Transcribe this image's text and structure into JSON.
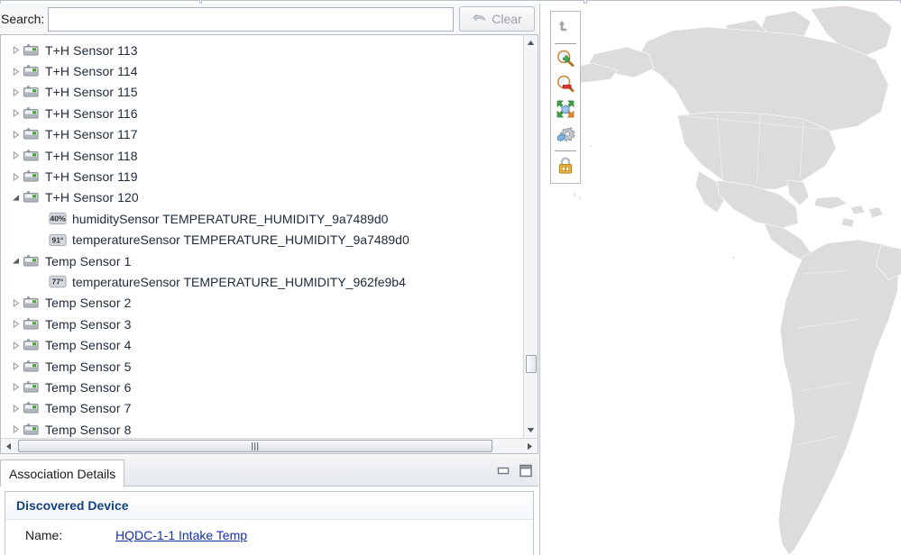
{
  "window": {
    "top_tabs": [
      "",
      "",
      ""
    ]
  },
  "search": {
    "label": "Search:",
    "value": "",
    "placeholder": "",
    "clear_label": "Clear",
    "clear_icon": "undo-arrow-icon",
    "clear_enabled": false
  },
  "tree": {
    "rows": [
      {
        "level": 0,
        "icon": "sensor-device-icon",
        "expanded": false,
        "label": "T+H Sensor 113"
      },
      {
        "level": 0,
        "icon": "sensor-device-icon",
        "expanded": false,
        "label": "T+H Sensor 114"
      },
      {
        "level": 0,
        "icon": "sensor-device-icon",
        "expanded": false,
        "label": "T+H Sensor 115"
      },
      {
        "level": 0,
        "icon": "sensor-device-icon",
        "expanded": false,
        "label": "T+H Sensor 116"
      },
      {
        "level": 0,
        "icon": "sensor-device-icon",
        "expanded": false,
        "label": "T+H Sensor 117"
      },
      {
        "level": 0,
        "icon": "sensor-device-icon",
        "expanded": false,
        "label": "T+H Sensor 118"
      },
      {
        "level": 0,
        "icon": "sensor-device-icon",
        "expanded": false,
        "label": "T+H Sensor 119"
      },
      {
        "level": 0,
        "icon": "sensor-device-icon",
        "expanded": true,
        "label": "T+H Sensor 120"
      },
      {
        "level": 1,
        "icon": "humidity-reading-badge",
        "badge": "40%",
        "label": "humiditySensor TEMPERATURE_HUMIDITY_9a7489d0"
      },
      {
        "level": 1,
        "icon": "temperature-reading-badge",
        "badge": "91°",
        "label": "temperatureSensor TEMPERATURE_HUMIDITY_9a7489d0"
      },
      {
        "level": 0,
        "icon": "sensor-device-icon",
        "expanded": true,
        "label": "Temp Sensor 1"
      },
      {
        "level": 1,
        "icon": "temperature-reading-badge",
        "badge": "77°",
        "label": "temperatureSensor TEMPERATURE_HUMIDITY_962fe9b4"
      },
      {
        "level": 0,
        "icon": "sensor-device-icon",
        "expanded": false,
        "label": "Temp Sensor 2"
      },
      {
        "level": 0,
        "icon": "sensor-device-icon",
        "expanded": false,
        "label": "Temp Sensor 3"
      },
      {
        "level": 0,
        "icon": "sensor-device-icon",
        "expanded": false,
        "label": "Temp Sensor 4"
      },
      {
        "level": 0,
        "icon": "sensor-device-icon",
        "expanded": false,
        "label": "Temp Sensor 5"
      },
      {
        "level": 0,
        "icon": "sensor-device-icon",
        "expanded": false,
        "label": "Temp Sensor 6"
      },
      {
        "level": 0,
        "icon": "sensor-device-icon",
        "expanded": false,
        "label": "Temp Sensor 7"
      },
      {
        "level": 0,
        "icon": "sensor-device-icon",
        "expanded": false,
        "label": "Temp Sensor 8"
      }
    ],
    "scroll": {
      "vertical_thumb_position": "near-bottom",
      "up_arrow_icon": "triangle-up-icon",
      "down_arrow_icon": "triangle-down-icon",
      "left_arrow_icon": "triangle-left-icon",
      "right_arrow_icon": "triangle-right-icon"
    }
  },
  "details": {
    "tab_label": "Association Details",
    "minimize_icon": "minimize-icon",
    "maximize_icon": "maximize-icon",
    "section_title": "Discovered Device",
    "fields": [
      {
        "label": "Name:",
        "value": "HQDC-1-1 Intake Temp",
        "type": "link"
      }
    ]
  },
  "map": {
    "toolbar": [
      {
        "name": "undo-icon",
        "tooltip": "Undo",
        "enabled": false
      },
      {
        "separator": true
      },
      {
        "name": "zoom-in-icon",
        "tooltip": "Zoom In",
        "enabled": true
      },
      {
        "name": "zoom-out-icon",
        "tooltip": "Zoom Out",
        "enabled": true
      },
      {
        "name": "fit-to-view-icon",
        "tooltip": "Fit To View",
        "enabled": true
      },
      {
        "name": "settings-gear-icon",
        "tooltip": "Settings",
        "enabled": true
      },
      {
        "separator": true
      },
      {
        "name": "lock-icon",
        "tooltip": "Lock",
        "enabled": true
      }
    ],
    "land_color": "#dcdcdc",
    "ocean_color": "#ffffff",
    "region_shown": "Americas"
  }
}
